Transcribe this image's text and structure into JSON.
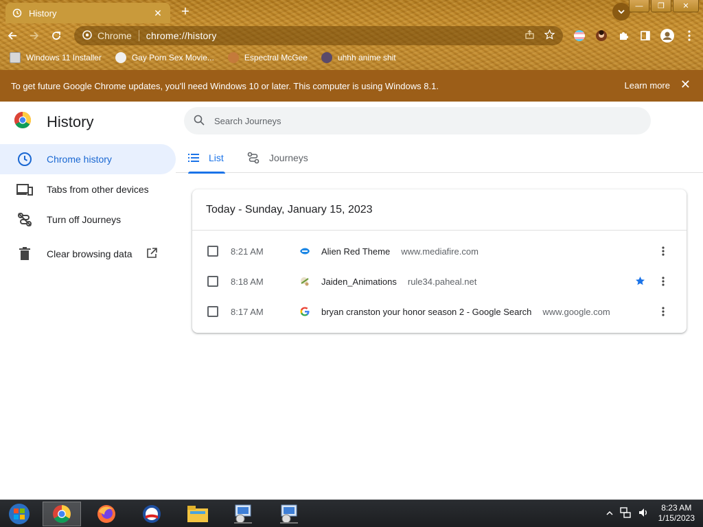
{
  "browser": {
    "tab_title": "History",
    "new_tab": "+",
    "window_controls": {
      "minimize": "—",
      "maximize": "❐",
      "close": "✕"
    },
    "omnibox": {
      "site_label": "Chrome",
      "url": "chrome://history"
    },
    "bookmarks": [
      {
        "label": "Windows 11 Installer",
        "icon": "image-icon",
        "color": "#d7d7d7"
      },
      {
        "label": "Gay Porn Sex Movie...",
        "icon": "spider-icon",
        "color": "#f0f0f0"
      },
      {
        "label": "Espectral McGee",
        "icon": "avatar-icon",
        "color": "#c47a3b"
      },
      {
        "label": "uhhh anime shit",
        "icon": "anime-icon",
        "color": "#5a4a6a"
      }
    ]
  },
  "infobar": {
    "message": "To get future Google Chrome updates, you'll need Windows 10 or later. This computer is using Windows 8.1.",
    "learn_more": "Learn more",
    "close": "✕"
  },
  "history_page": {
    "title": "History",
    "search_placeholder": "Search Journeys",
    "sidebar": [
      {
        "label": "Chrome history",
        "icon": "clock-icon",
        "active": true
      },
      {
        "label": "Tabs from other devices",
        "icon": "devices-icon",
        "active": false
      },
      {
        "label": "Turn off Journeys",
        "icon": "journeys-off-icon",
        "active": false
      },
      {
        "label": "Clear browsing data",
        "icon": "trash-icon",
        "active": false
      }
    ],
    "tabs": [
      {
        "label": "List",
        "icon": "list-icon",
        "active": true
      },
      {
        "label": "Journeys",
        "icon": "journeys-icon",
        "active": false
      }
    ],
    "day_heading": "Today - Sunday, January 15, 2023",
    "entries": [
      {
        "time": "8:21 AM",
        "title": "Alien Red Theme",
        "domain": "www.mediafire.com",
        "favicon": "mediafire-icon",
        "starred": false
      },
      {
        "time": "8:18 AM",
        "title": "Jaiden_Animations",
        "domain": "rule34.paheal.net",
        "favicon": "paheal-icon",
        "starred": true
      },
      {
        "time": "8:17 AM",
        "title": "bryan cranston your honor season 2 - Google Search",
        "domain": "www.google.com",
        "favicon": "google-icon",
        "starred": false
      }
    ]
  },
  "taskbar": {
    "apps": [
      "start-orb-icon",
      "chrome-icon",
      "firefox-icon",
      "obama-icon",
      "file-explorer-icon",
      "installer-icon",
      "installer-icon"
    ],
    "clock_time": "8:23 AM",
    "clock_date": "1/15/2023"
  },
  "colors": {
    "accent": "#1a73e8",
    "infobar_bg": "#9c5e18",
    "active_side_bg": "#e8f0fe"
  }
}
